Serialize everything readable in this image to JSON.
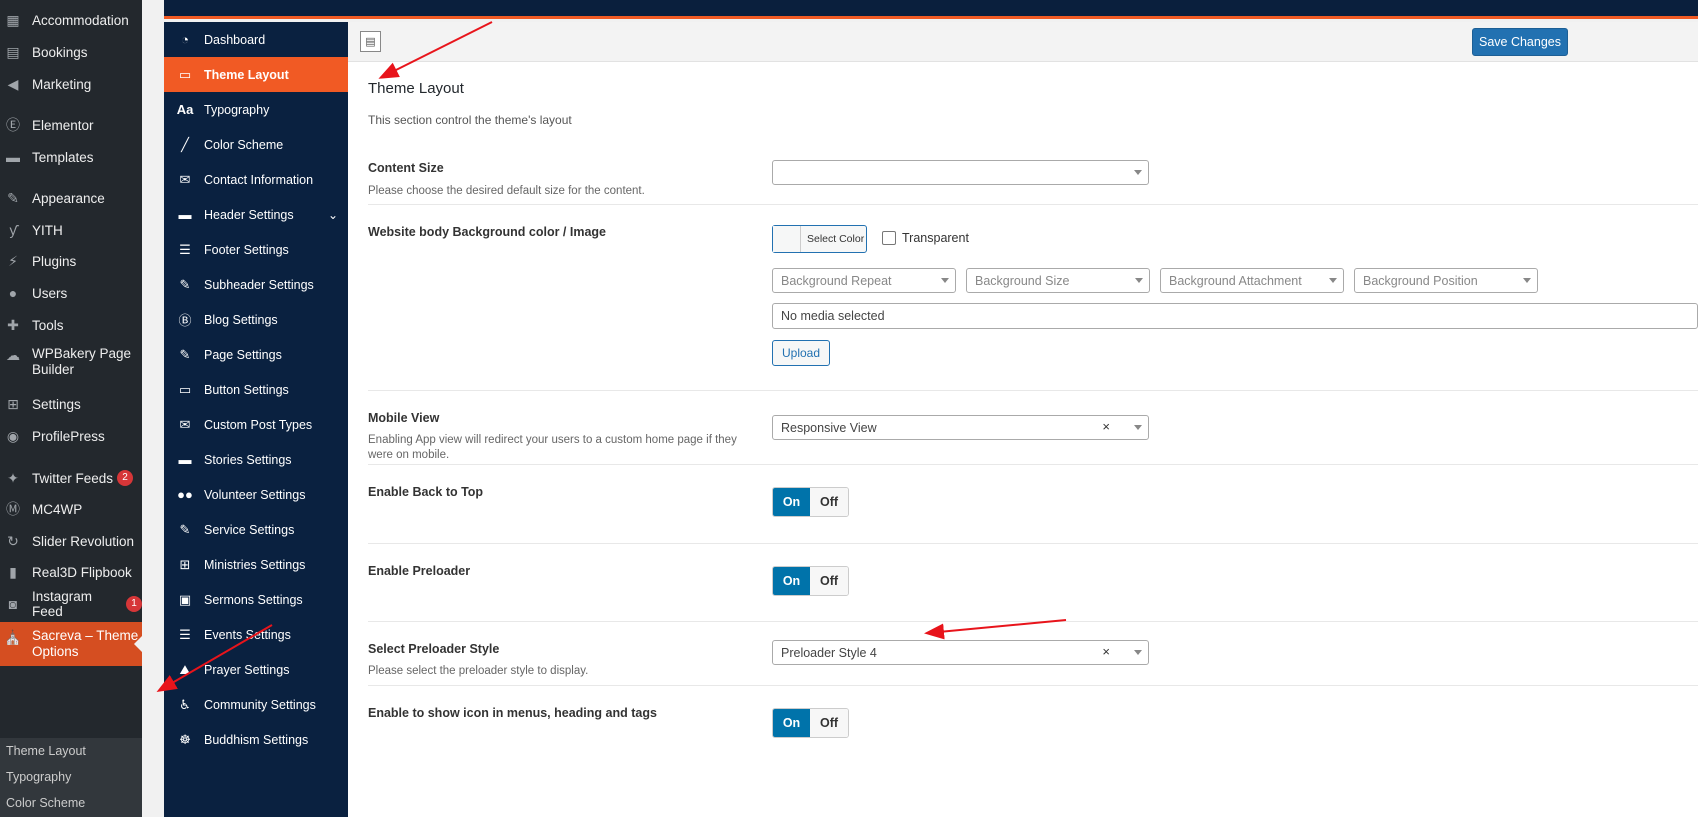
{
  "wp_menu": [
    {
      "label": "Accommodation",
      "icon": "building-icon"
    },
    {
      "label": "Bookings",
      "icon": "calendar-icon"
    },
    {
      "label": "Marketing",
      "icon": "megaphone-icon"
    },
    {
      "label": "Elementor",
      "icon": "elementor-icon"
    },
    {
      "label": "Templates",
      "icon": "folder-icon"
    },
    {
      "label": "Appearance",
      "icon": "paintbrush-icon"
    },
    {
      "label": "YITH",
      "icon": "yith-icon"
    },
    {
      "label": "Plugins",
      "icon": "plug-icon"
    },
    {
      "label": "Users",
      "icon": "user-icon"
    },
    {
      "label": "Tools",
      "icon": "wrench-icon"
    },
    {
      "label": "WPBakery Page Builder",
      "icon": "cloud-icon"
    },
    {
      "label": "Settings",
      "icon": "sliders-icon"
    },
    {
      "label": "ProfilePress",
      "icon": "profilepress-icon"
    },
    {
      "label": "Twitter Feeds",
      "icon": "twitter-icon",
      "badge": "2"
    },
    {
      "label": "MC4WP",
      "icon": "mc4wp-icon"
    },
    {
      "label": "Slider Revolution",
      "icon": "revolution-icon"
    },
    {
      "label": "Real3D Flipbook",
      "icon": "book-icon"
    },
    {
      "label": "Instagram Feed",
      "icon": "camera-icon",
      "badge": "1"
    },
    {
      "label": "Sacreva – Theme Options",
      "icon": "church-icon",
      "active": true
    }
  ],
  "wp_submenu": [
    "Theme Layout",
    "Typography",
    "Color Scheme"
  ],
  "options_menu": [
    {
      "label": "Dashboard",
      "icon": "gauge-icon"
    },
    {
      "label": "Theme Layout",
      "icon": "monitor-icon",
      "active": true
    },
    {
      "label": "Typography",
      "icon": "typography-icon"
    },
    {
      "label": "Color Scheme",
      "icon": "brush-icon"
    },
    {
      "label": "Contact Information",
      "icon": "envelope-icon"
    },
    {
      "label": "Header Settings",
      "icon": "header-icon",
      "expandable": true
    },
    {
      "label": "Footer Settings",
      "icon": "footer-icon"
    },
    {
      "label": "Subheader Settings",
      "icon": "edit-icon"
    },
    {
      "label": "Blog Settings",
      "icon": "blog-icon"
    },
    {
      "label": "Page Settings",
      "icon": "edit-page-icon"
    },
    {
      "label": "Button Settings",
      "icon": "button-icon"
    },
    {
      "label": "Custom Post Types",
      "icon": "mail-icon"
    },
    {
      "label": "Stories Settings",
      "icon": "folder-icon"
    },
    {
      "label": "Volunteer Settings",
      "icon": "group-icon"
    },
    {
      "label": "Service Settings",
      "icon": "edit-service-icon"
    },
    {
      "label": "Ministries Settings",
      "icon": "grid-icon"
    },
    {
      "label": "Sermons Settings",
      "icon": "sermon-icon"
    },
    {
      "label": "Events Settings",
      "icon": "events-icon"
    },
    {
      "label": "Prayer Settings",
      "icon": "prayer-icon"
    },
    {
      "label": "Community Settings",
      "icon": "accessibility-icon"
    },
    {
      "label": "Buddhism Settings",
      "icon": "buddhism-icon"
    }
  ],
  "toolbar": {
    "save_label": "Save Changes"
  },
  "section": {
    "title": "Theme Layout",
    "description": "This section control the theme's layout"
  },
  "fields": {
    "content_size": {
      "label": "Content Size",
      "description": "Please choose the desired default size for the content.",
      "value": ""
    },
    "background": {
      "label": "Website body Background color / Image",
      "color_button": "Select Color",
      "transparent_label": "Transparent",
      "repeat_placeholder": "Background Repeat",
      "size_placeholder": "Background Size",
      "attachment_placeholder": "Background Attachment",
      "position_placeholder": "Background Position",
      "media_text": "No media selected",
      "upload_label": "Upload"
    },
    "mobile_view": {
      "label": "Mobile View",
      "description": "Enabling App view will redirect your users to a custom home page if they were on mobile.",
      "value": "Responsive View"
    },
    "back_to_top": {
      "label": "Enable Back to Top",
      "on": "On",
      "off": "Off"
    },
    "preloader": {
      "label": "Enable Preloader",
      "on": "On",
      "off": "Off"
    },
    "preloader_style": {
      "label": "Select Preloader Style",
      "description": "Please select the preloader style to display.",
      "value": "Preloader Style 4"
    },
    "menu_icons": {
      "label": "Enable to show icon in menus, heading and tags",
      "on": "On",
      "off": "Off"
    }
  },
  "colors": {
    "accent_orange": "#f15a24",
    "navy": "#0a2140",
    "wp_dark": "#23282d",
    "blue": "#0073aa",
    "annotation_red": "#e8141b"
  }
}
